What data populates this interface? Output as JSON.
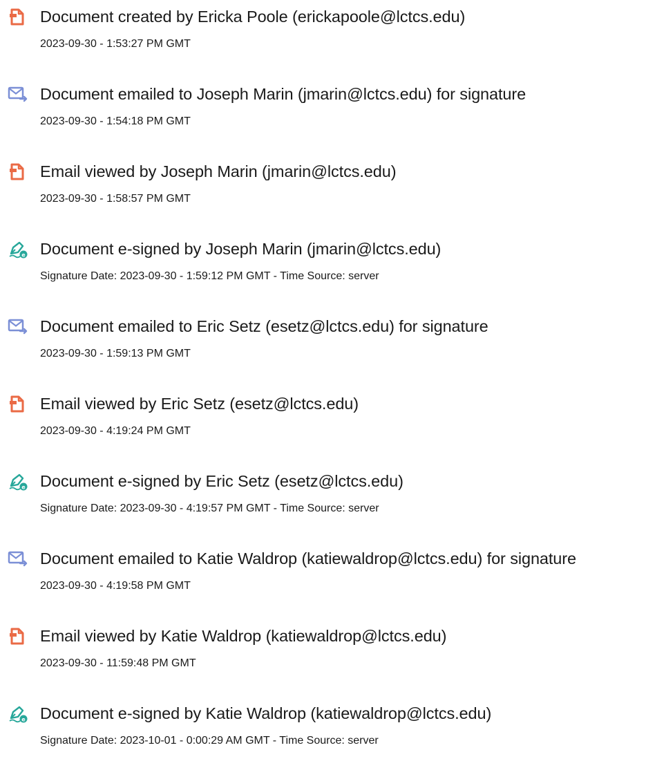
{
  "audit_history": [
    {
      "icon": "document-created-icon",
      "title": "Document created by Ericka Poole (erickapoole@lctcs.edu)",
      "detail": "2023-09-30 - 1:53:27 PM GMT"
    },
    {
      "icon": "email-sent-icon",
      "title": "Document emailed to Joseph Marin (jmarin@lctcs.edu) for signature",
      "detail": "2023-09-30 - 1:54:18 PM GMT"
    },
    {
      "icon": "document-viewed-icon",
      "title": "Email viewed by Joseph Marin (jmarin@lctcs.edu)",
      "detail": "2023-09-30 - 1:58:57 PM GMT"
    },
    {
      "icon": "esign-pen-icon",
      "title": "Document e-signed by Joseph Marin (jmarin@lctcs.edu)",
      "detail": "Signature Date: 2023-09-30 - 1:59:12 PM GMT - Time Source: server"
    },
    {
      "icon": "email-sent-icon",
      "title": "Document emailed to Eric Setz (esetz@lctcs.edu) for signature",
      "detail": "2023-09-30 - 1:59:13 PM GMT"
    },
    {
      "icon": "document-viewed-icon",
      "title": "Email viewed by Eric Setz (esetz@lctcs.edu)",
      "detail": "2023-09-30 - 4:19:24 PM GMT"
    },
    {
      "icon": "esign-pen-icon",
      "title": "Document e-signed by Eric Setz (esetz@lctcs.edu)",
      "detail": "Signature Date: 2023-09-30 - 4:19:57 PM GMT - Time Source: server"
    },
    {
      "icon": "email-sent-icon",
      "title": "Document emailed to Katie Waldrop (katiewaldrop@lctcs.edu) for signature",
      "detail": "2023-09-30 - 4:19:58 PM GMT"
    },
    {
      "icon": "document-viewed-icon",
      "title": "Email viewed by Katie Waldrop (katiewaldrop@lctcs.edu)",
      "detail": "2023-09-30 - 11:59:48 PM GMT"
    },
    {
      "icon": "esign-pen-icon",
      "title": "Document e-signed by Katie Waldrop (katiewaldrop@lctcs.edu)",
      "detail": "Signature Date: 2023-10-01 - 0:00:29 AM GMT - Time Source: server"
    }
  ],
  "colors": {
    "doc_icon": "#ea6a45",
    "mail_icon": "#7b8fd6",
    "pen_icon": "#27a79a",
    "text": "#1a1a1a"
  }
}
